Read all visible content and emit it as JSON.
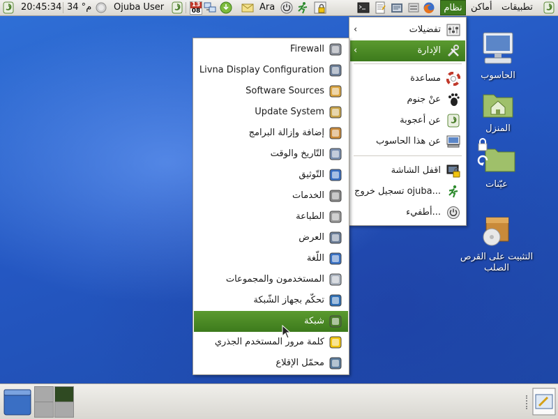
{
  "top_panel": {
    "menus": {
      "applications": "تطبيقات",
      "places": "أماكن",
      "system": "نظام"
    },
    "keyboard_layout": "Ara",
    "user_name": "Ojuba User",
    "temperature": "34 °م",
    "clock": "20:45:34",
    "calendar_top": "13",
    "calendar_bottom": "08"
  },
  "system_menu": {
    "items": [
      {
        "label": "تفضيلات",
        "icon": "preferences-icon",
        "submenu": true
      },
      {
        "label": "الإدارة",
        "icon": "tools-icon",
        "submenu": true
      },
      {
        "label": "مساعدة",
        "icon": "help-lifebuoy-icon"
      },
      {
        "label": "عنْ جنوم",
        "icon": "gnome-foot-icon"
      },
      {
        "label": "عن أعجوبة",
        "icon": "ojuba-swirl-icon"
      },
      {
        "label": "عن هذا الحاسوب",
        "icon": "computer-icon"
      },
      {
        "label": "اقفل الشاشة",
        "icon": "lock-screen-icon"
      },
      {
        "label": "تسجيل خروج ojuba...",
        "icon": "logout-running-man-icon"
      },
      {
        "label": "أطفيء...",
        "icon": "power-icon"
      }
    ]
  },
  "admin_menu": {
    "items": [
      "Firewall",
      "Livna Display Configuration",
      "Software Sources",
      "Update System",
      "إضافة وإزالة البرامج",
      "التّاريخ والوقت",
      "التّوثيق",
      "الخدمات",
      "الطباعة",
      "العرض",
      "اللّغة",
      "المستخدمون والمجموعات",
      "تحكّم بجهاز الشّبكة",
      "شبكة",
      "كلمة مرور المستخدم الجذري",
      "محمّل الإقلاع"
    ],
    "highlighted_index": 13
  },
  "desktop_icons": {
    "computer": "الحاسوب",
    "home": "المنزل",
    "samples": "عيّنات",
    "install_line1": "التثبيت على القرص",
    "install_line2": "الصلب"
  },
  "colors": {
    "highlight": "#4a8a25",
    "desktop": "#2a5fc4"
  }
}
